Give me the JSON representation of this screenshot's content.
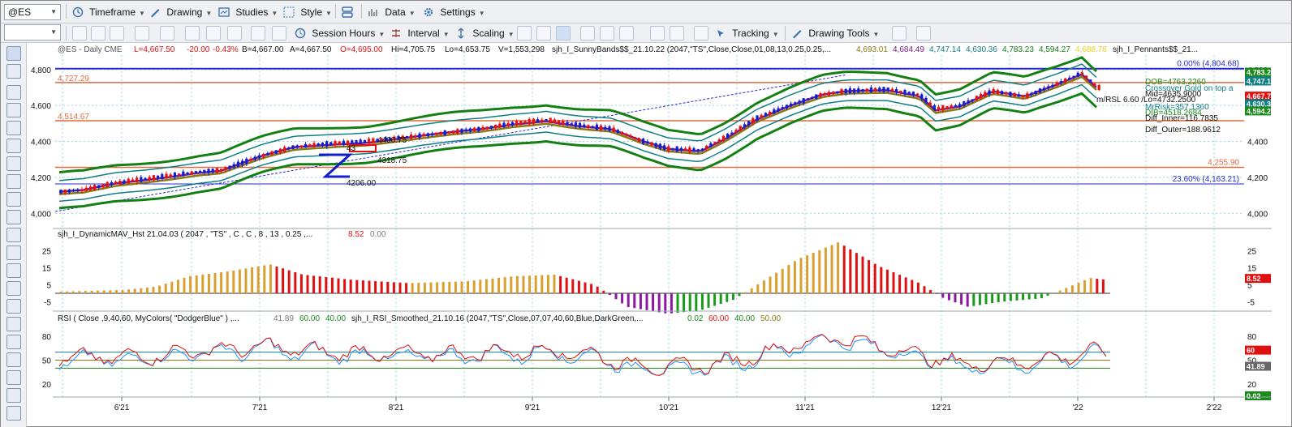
{
  "toolbar1": {
    "symbol": "@ES",
    "items": [
      {
        "label": "Timeframe",
        "icon": "timeframe-icon"
      },
      {
        "label": "Drawing",
        "icon": "drawing-icon"
      },
      {
        "label": "Studies",
        "icon": "studies-icon"
      },
      {
        "label": "Style",
        "icon": "style-icon"
      },
      {
        "label": "Data",
        "icon": "data-icon"
      },
      {
        "label": "Settings",
        "icon": "settings-icon"
      }
    ]
  },
  "toolbar2": {
    "combo_value": "",
    "session_hours": "Session Hours",
    "interval": "Interval",
    "scaling": "Scaling",
    "tracking": "Tracking",
    "drawing_tools": "Drawing Tools"
  },
  "price_header": {
    "sym": "@ES - Daily  CME",
    "last": "L=4,667.50",
    "chg": "-20.00",
    "pct": "-0.43%",
    "bid": "B=4,667.00",
    "ask": "A=4,667.50",
    "open": "O=4,695.00",
    "hi": "Hi=4,705.75",
    "lo": "Lo=4,653.75",
    "vol": "V=1,553,298",
    "study": "sjh_I_SunnyBands$$_21.10.22 (2047,\"TS\",Close,Close,01,08,13,0.25,0.25,...",
    "v1": "4,693.01",
    "v2": "4,684.49",
    "v3": "4,747.14",
    "v4": "4,630.36",
    "v5": "4,783.23",
    "v6": "4,594.27",
    "v7": "4,688.78",
    "study2": "sjh_I_Pennants$$_21..."
  },
  "price_levels": {
    "l1": "4,727.29",
    "l2": "4,514.67",
    "l3": "4,255.90",
    "fib0": "0.00% (4,804.68)",
    "fib236": "23.60% (4,163.21)"
  },
  "annotations": {
    "a1": "4400.75",
    "a2": "4318.75",
    "a3": "4206.00",
    "a4": "43",
    "dob": "DOB=4763.2260",
    "crossover": "Crossover Gold on top a",
    "mrsi": "m/RSL 6.60 /Lo=4732.2500",
    "mid": "Mid=4635.9000",
    "mrrisk": "MrRisk=357.1360",
    "dib": "DIB=4518.2684",
    "diff_inner": "Diff_Inner=116.7835",
    "diff_outer": "Diff_Outer=188.9612"
  },
  "price_axis": {
    "ticks": [
      "4,800",
      "4,600",
      "4,400",
      "4,200",
      "4,000"
    ],
    "right_ticks": [
      "4,800",
      "4,600",
      "4,400",
      "4,200",
      "4,000"
    ],
    "badges": [
      {
        "text": "4,783.2",
        "color": "#1a8a1a"
      },
      {
        "text": "4,747.1",
        "color": "#0f7f85"
      },
      {
        "text": "4,667.7",
        "color": "#e01010"
      },
      {
        "text": "4,630.3",
        "color": "#0f7f85"
      },
      {
        "text": "4,594.2",
        "color": "#1a8a1a"
      }
    ]
  },
  "mav_panel": {
    "title": "sjh_I_DynamicMAV_Hst 21.04.03 ( 2047 , \"TS\" , C , C ,  8 , 13 , 0.25 ,...",
    "v1": "8.52",
    "v2": "0.00",
    "ticks": [
      "25",
      "15",
      "5",
      "-5"
    ],
    "badge": "8.52"
  },
  "rsi_panel": {
    "title": "RSI ( Close ,9,40,60, MyColors( \"DodgerBlue\" ) ,...",
    "v1": "41.89",
    "v2": "60.00",
    "v3": "40.00",
    "study": "sjh_I_RSI_Smoothed_21.10.16 (2047,\"TS\",Close,07,07,40,60,Blue,DarkGreen,...",
    "s1": "0.02",
    "s2": "60.00",
    "s3": "40.00",
    "s4": "50.00",
    "ticks": [
      "80",
      "50",
      "20"
    ],
    "badges": [
      {
        "text": "60",
        "color": "#e01010"
      },
      {
        "text": "41.89",
        "color": "#666666"
      },
      {
        "text": "0.02",
        "color": "#1a8a1a"
      }
    ]
  },
  "time_axis": [
    "6'21",
    "7'21",
    "8'21",
    "9'21",
    "10'21",
    "11'21",
    "12'21",
    "'22",
    "2'22"
  ],
  "colors": {
    "up": "#1020d0",
    "down": "#e81010",
    "outer_band": "#148014",
    "inner_band": "#0f7f85",
    "mid": "#8a7a10",
    "avg": "#7a1a8a",
    "fib": "#2a2ad0",
    "level": "#e06a40",
    "hist_orange": "#d9a030",
    "hist_red": "#e01010",
    "hist_green": "#1a9a1a",
    "hist_purple": "#8a1aa0"
  }
}
